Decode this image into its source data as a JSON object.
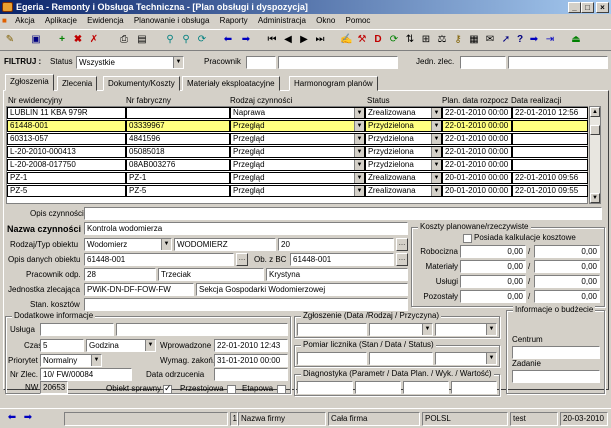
{
  "window": {
    "title": "Egeria - Remonty i Obsługa Techniczna - [Plan obsługi i dyspozycja]"
  },
  "menu": [
    "Akcja",
    "Aplikacje",
    "Ewidencja",
    "Planowanie i obsługa",
    "Raporty",
    "Administracja",
    "Okno",
    "Pomoc"
  ],
  "filter": {
    "label": "FILTRUJ :",
    "status_label": "Status",
    "status_value": "Wszystkie",
    "pracownik_label": "Pracownik",
    "jedn_label": "Jedn. zlec."
  },
  "tabs": [
    "Zgłoszenia",
    "Zlecenia",
    "Dokumenty/Koszty",
    "Materiały eksploatacyjne",
    "Harmonogram planów"
  ],
  "grid": {
    "headers": [
      "Nr ewidencyjny",
      "Nr fabryczny",
      "Rodzaj czynności",
      "Status",
      "Plan. data rozpocz",
      "Data realizacji"
    ],
    "rows": [
      [
        "LUBLIN 11  KBA 979R",
        "",
        "Naprawa",
        "Zrealizowana",
        "22-01-2010 00:00",
        "22-01-2010 12:56"
      ],
      [
        "61448-001",
        "03339967",
        "Przegląd",
        "Przydzielona",
        "22-01-2010 00:00",
        ""
      ],
      [
        "60313-057",
        "4841596",
        "Przegląd",
        "Przydzielona",
        "22-01-2010 00:00",
        ""
      ],
      [
        "L-20-2010-000413",
        "05085018",
        "Przegląd",
        "Przydzielona",
        "22-01-2010 00:00",
        ""
      ],
      [
        "L-20-2008-017750",
        "08AB003276",
        "Przegląd",
        "Przydzielona",
        "22-01-2010 00:00",
        ""
      ],
      [
        "PZ-1",
        "PZ-1",
        "Przegląd",
        "Zrealizowana",
        "20-01-2010 00:00",
        "22-01-2010 09:56"
      ],
      [
        "PZ-5",
        "PZ-5",
        "Przegląd",
        "Zrealizowana",
        "20-01-2010 00:00",
        "22-01-2010 09:55"
      ]
    ]
  },
  "details": {
    "opis_label": "Opis czynności",
    "nazwa_label": "Nazwa czynności",
    "nazwa_value": "Kontrola wodomierza",
    "rodzaj_label": "Rodzaj/Typ obiektu",
    "rodzaj_value": "Wodomierz",
    "typ_value": "WODOMIERZ",
    "typ_num": "20",
    "opis_danych_label": "Opis danych obiektu",
    "opis_danych_value": "61448-001",
    "ob_label": "Ob. z BC",
    "ob_value": "61448-001",
    "prac_label": "Pracownik odp.",
    "prac_num": "28",
    "prac_nazwisko": "Trzeciak",
    "prac_imie": "Krystyna",
    "jedn_label": "Jednostka zlecająca",
    "jedn_code": "PWiK-DN-DF-FOW-FW",
    "jedn_name": "Sekcja Gospodarki Wodomierzowej",
    "stan_label": "Stan. kosztów"
  },
  "koszty": {
    "title": "Koszty planowane/rzeczywiste",
    "posiada": "Posiada kalkulacje kosztowe",
    "rows": [
      {
        "label": "Robocizna",
        "plan": "0,00",
        "rz": "0,00"
      },
      {
        "label": "Materiały",
        "plan": "0,00",
        "rz": "0,00"
      },
      {
        "label": "Usługi",
        "plan": "0,00",
        "rz": "0,00"
      },
      {
        "label": "Pozostały",
        "plan": "0,00",
        "rz": "0,00"
      }
    ]
  },
  "dodatkowe": {
    "title": "Dodatkowe informacje",
    "usluga": "Usługa",
    "czas": "Czas",
    "czas_value": "5",
    "czas_unit": "Godzina",
    "wprow": "Wprowadzone",
    "wprow_value": "22-01-2010 12:43",
    "priorytet": "Priorytet",
    "priorytet_value": "Normalny",
    "wymag": "Wymag. zakoń.",
    "wymag_value": "31-01-2010 00:00",
    "nrzlec": "Nr Zlec.",
    "nrzlec_value": "10/ FW/00084",
    "data_odrz": "Data odrzucenia",
    "nw": "NW",
    "nw_value": "20653",
    "sprawny": "Obiekt sprawny",
    "przestojowa": "Przestojowa",
    "etapowa": "Etapowa"
  },
  "zgloszenie": {
    "title": "Zgłoszenie (Data /Rodzaj / Przyczyna)"
  },
  "pomiar": {
    "title": "Pomiar licznika (Stan / Data / Status)"
  },
  "diag": {
    "title": "Diagnostyka (Parametr / Data Plan. / Wyk. / Wartość)"
  },
  "budzet": {
    "title": "Informacje o budżecie",
    "centrum": "Centrum",
    "zadanie": "Zadanie"
  },
  "statusbar": {
    "num": "1",
    "firma": "Nazwa firmy",
    "cala": "Cała firma",
    "polsl": "POLSL",
    "test": "test",
    "date": "20-03-2010"
  }
}
